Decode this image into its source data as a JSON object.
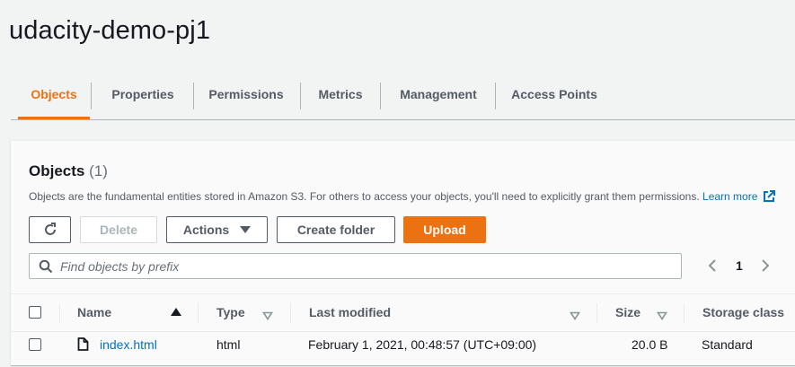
{
  "bucket_name": "udacity-demo-pj1",
  "tabs": [
    {
      "label": "Objects",
      "active": true
    },
    {
      "label": "Properties"
    },
    {
      "label": "Permissions"
    },
    {
      "label": "Metrics"
    },
    {
      "label": "Management"
    },
    {
      "label": "Access Points"
    }
  ],
  "panel": {
    "title": "Objects",
    "count": "(1)",
    "description": "Objects are the fundamental entities stored in Amazon S3. For others to access your objects, you'll need to explicitly grant them permissions.",
    "learn_more": "Learn more"
  },
  "toolbar": {
    "delete_label": "Delete",
    "actions_label": "Actions",
    "create_folder_label": "Create folder",
    "upload_label": "Upload"
  },
  "search": {
    "placeholder": "Find objects by prefix"
  },
  "pagination": {
    "current_page": "1"
  },
  "table": {
    "columns": [
      "Name",
      "Type",
      "Last modified",
      "Size",
      "Storage class"
    ],
    "rows": [
      {
        "name": "index.html",
        "type": "html",
        "last_modified": "February 1, 2021, 00:48:57 (UTC+09:00)",
        "size": "20.0 B",
        "storage_class": "Standard"
      }
    ]
  },
  "colors": {
    "accent": "#ec7211",
    "link": "#0073bb",
    "text": "#16191f"
  },
  "icons": [
    "refresh-icon",
    "caret-down-icon",
    "search-icon",
    "chevron-left-icon",
    "chevron-right-icon",
    "sort-ascending-icon",
    "sort-descending-icon",
    "file-icon",
    "external-link-icon"
  ]
}
